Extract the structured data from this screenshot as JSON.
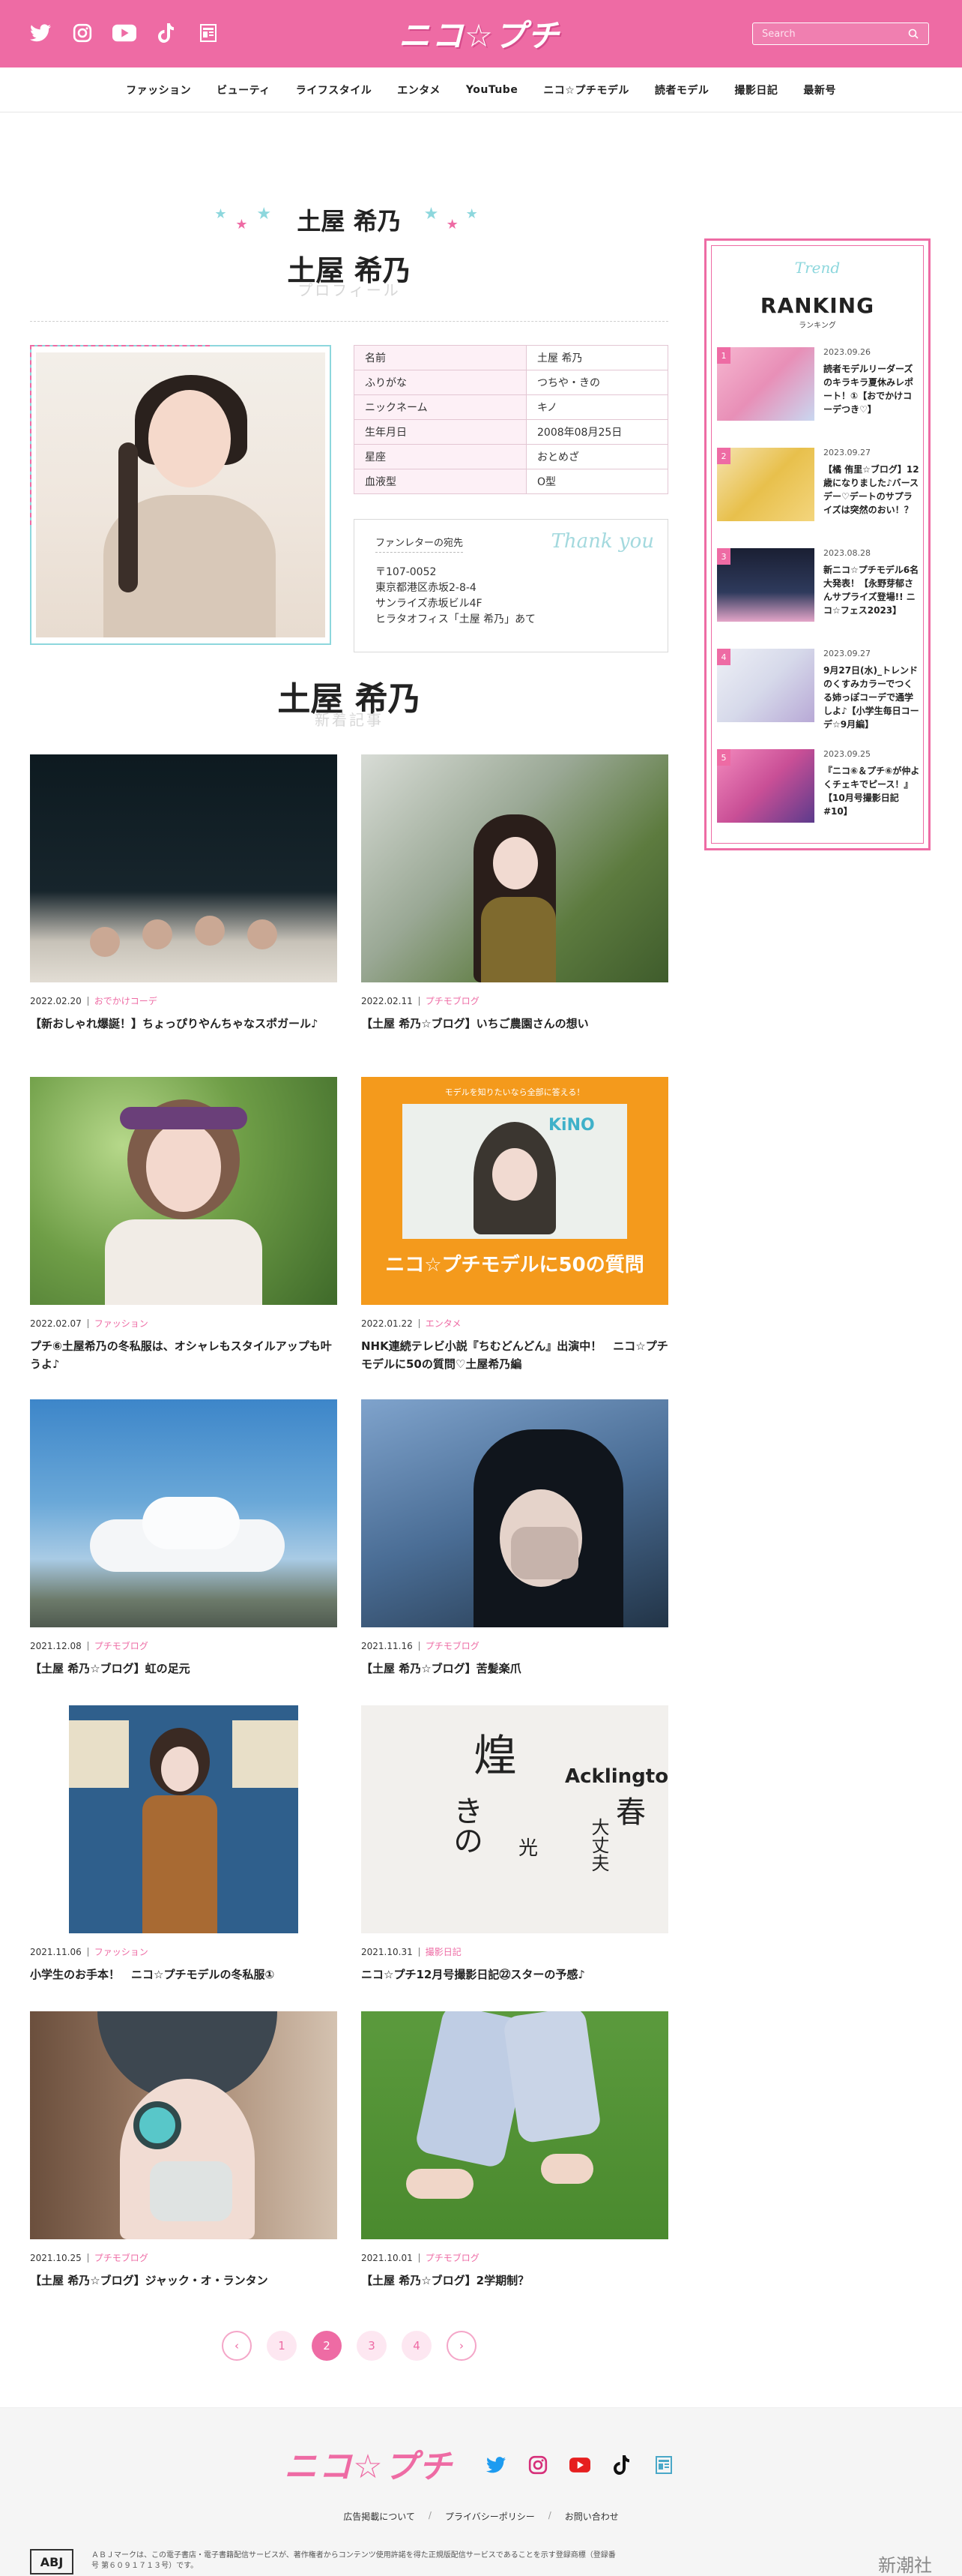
{
  "header": {
    "logo": "ニコ☆プチ",
    "search_placeholder": "Search",
    "social": [
      "twitter-icon",
      "instagram-icon",
      "youtube-icon",
      "tiktok-icon",
      "magazine-icon"
    ]
  },
  "nav": [
    "ファッション",
    "ビューティ",
    "ライフスタイル",
    "エンタメ",
    "YouTube",
    "ニコ☆プチモデル",
    "読者モデル",
    "撮影日記",
    "最新号"
  ],
  "profile": {
    "name_top": "土屋 希乃",
    "name": "土屋 希乃",
    "subtitle": "プロフィール",
    "table": [
      {
        "k": "名前",
        "v": "土屋 希乃"
      },
      {
        "k": "ふりがな",
        "v": "つちや・きの"
      },
      {
        "k": "ニックネーム",
        "v": "キノ"
      },
      {
        "k": "生年月日",
        "v": "2008年08月25日"
      },
      {
        "k": "星座",
        "v": "おとめざ"
      },
      {
        "k": "血液型",
        "v": "O型"
      }
    ],
    "fan_title": "ファンレターの宛先",
    "fan_deco": "Thank you",
    "fan_address": [
      "〒107-0052",
      "東京都港区赤坂2-8-4",
      "サンライズ赤坂ビル4F",
      "ヒラタオフィス「土屋 希乃」あて"
    ]
  },
  "articles_head": {
    "title": "土屋 希乃",
    "subtitle": "新着記事"
  },
  "articles": [
    {
      "date": "2022.02.20",
      "cat": "おでかけコーデ",
      "title": "【新おしゃれ爆誕！】ちょっぴりやんちゃなスポガール♪"
    },
    {
      "date": "2022.02.11",
      "cat": "プチモブログ",
      "title": "【土屋 希乃☆ブログ】いちご農園さんの想い"
    },
    {
      "date": "2022.02.07",
      "cat": "ファッション",
      "title": "プチ⑥土屋希乃の冬私服は、オシャレもスタイルアップも叶うよ♪"
    },
    {
      "date": "2022.01.22",
      "cat": "エンタメ",
      "title": "NHK連続テレビ小説『ちむどんどん』出演中！　ニコ☆プチモデルに50の質問♡土屋希乃編"
    },
    {
      "date": "2021.12.08",
      "cat": "プチモブログ",
      "title": "【土屋 希乃☆ブログ】虹の足元"
    },
    {
      "date": "2021.11.16",
      "cat": "プチモブログ",
      "title": "【土屋 希乃☆ブログ】苦髪楽爪"
    },
    {
      "date": "2021.11.06",
      "cat": "ファッション",
      "title": "小学生のお手本！　ニコ☆プチモデルの冬私服①"
    },
    {
      "date": "2021.10.31",
      "cat": "撮影日記",
      "title": "ニコ☆プチ12月号撮影日記㉒スターの予感♪"
    },
    {
      "date": "2021.10.25",
      "cat": "プチモブログ",
      "title": "【土屋 希乃☆ブログ】ジャック・オ・ランタン"
    },
    {
      "date": "2021.10.01",
      "cat": "プチモブログ",
      "title": "【土屋 希乃☆ブログ】2学期制？"
    }
  ],
  "card_images": {
    "a4_text": "ニコ☆プチモデルに50の質問",
    "a4_top": "モデルを知りたいなら全部に答える！",
    "a4_name": "KiNO",
    "a8_words": [
      "煌",
      "きの",
      "Acklington",
      "春",
      "大丈夫",
      "光"
    ]
  },
  "pager": {
    "prev": "‹",
    "pages": [
      "1",
      "2",
      "3",
      "4"
    ],
    "current": "2",
    "next": "›"
  },
  "ranking": {
    "trend": "Trend",
    "title": "RANKING",
    "subtitle": "ランキング",
    "items": [
      {
        "num": "1",
        "date": "2023.09.26",
        "title": "読者モデルリーダーズのキラキラ夏休みレポート！①【おでかけコーデつき♡】"
      },
      {
        "num": "2",
        "date": "2023.09.27",
        "title": "【橘 侑里☆ブログ】12歳になりました♪バースデー♡デートのサプライズは突然のおい！？"
      },
      {
        "num": "3",
        "date": "2023.08.28",
        "title": "新ニコ☆プチモデル6名大発表！【永野芽郁さんサプライズ登場!! ニコ☆フェス2023】"
      },
      {
        "num": "4",
        "date": "2023.09.27",
        "title": "9月27日(水)_トレンドのくすみカラーでつくる姉っぽコーデで通学しよ♪【小学生毎日コーデ☆9月編】"
      },
      {
        "num": "5",
        "date": "2023.09.25",
        "title": "『ニコ⑥＆プチ⑥が仲よくチェキでピース！』【10月号撮影日記#10】"
      }
    ]
  },
  "footer": {
    "logo": "ニコ☆プチ",
    "links": [
      "広告掲載について",
      "プライバシーポリシー",
      "お問い合わせ"
    ],
    "sep": "/",
    "abj": "ABJ",
    "abj_text": "ＡＢＪマークは、この電子書店・電子書籍配信サービスが、著作権者からコンテンツ使用許諾を得た正規版配信サービスであることを示す登録商標（登録番号 第６０９１７１３号）です。",
    "publisher": "新潮社"
  },
  "colors": {
    "brand": "#ee6ba4",
    "accent": "#8dd7dd"
  }
}
